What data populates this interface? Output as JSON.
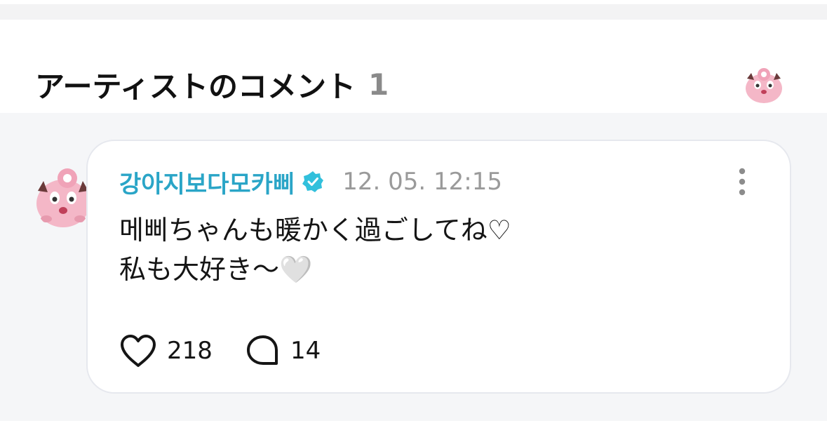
{
  "section": {
    "title": "アーティストのコメント",
    "count": "1"
  },
  "comment": {
    "author": "강아지보다모카삐",
    "verified_icon": "verified-badge-icon",
    "timestamp": "12. 05. 12:15",
    "lines": [
      "메삐ちゃんも暖かく過ごしてね♡",
      "私も大好き〜🤍"
    ],
    "likes": "218",
    "replies": "14"
  },
  "colors": {
    "author_name": "#2aa5c7",
    "verified_badge": "#32c0dc",
    "feed_background": "#f5f6f8",
    "avatar_pink": "#f4b7c7"
  },
  "icons": {
    "more": "more-vertical-icon",
    "like": "heart-outline-icon",
    "reply": "speech-bubble-icon",
    "avatar": "pink-creature-avatar"
  }
}
